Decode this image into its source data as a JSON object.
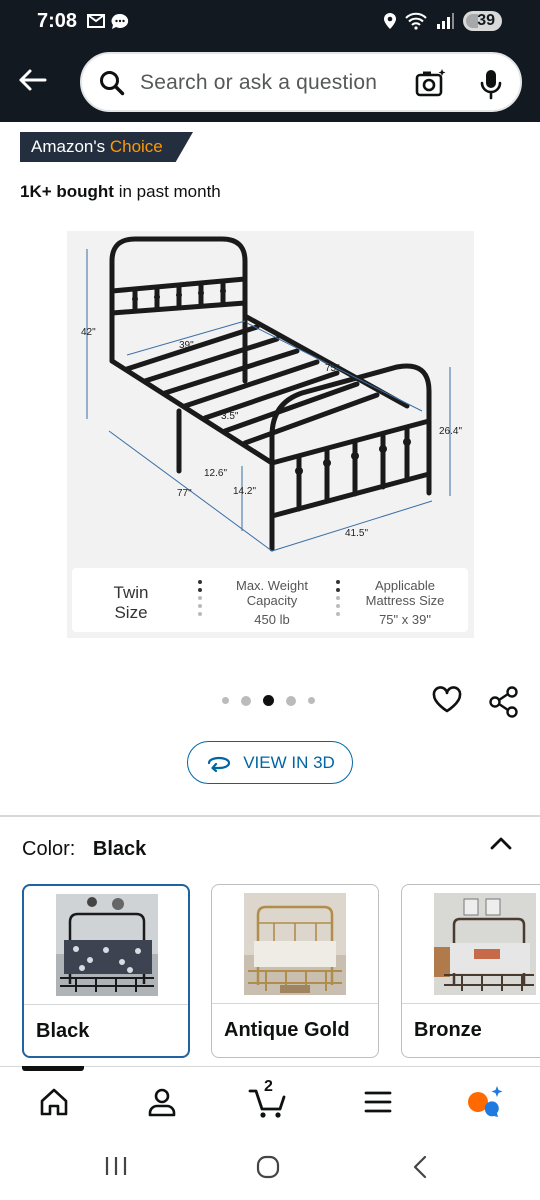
{
  "status": {
    "time": "7:08",
    "battery": "39"
  },
  "search": {
    "placeholder": "Search or ask a question"
  },
  "badge": {
    "prefix": "Amazon's",
    "accent": "Choice"
  },
  "bought": {
    "bold": "1K+ bought",
    "rest": "in past month"
  },
  "product_image": {
    "dims": {
      "headboard_height": "42\"",
      "width": "39\"",
      "length": "75\"",
      "footboard_height": "26.4\"",
      "slat_gap": "3.5\"",
      "clearance_low": "12.6\"",
      "clearance_high": "14.2\"",
      "outer_length": "77\"",
      "outer_width": "41.5\""
    },
    "specs": {
      "size_line1": "Twin",
      "size_line2": "Size",
      "weight_line1": "Max. Weight",
      "weight_line2": "Capacity",
      "weight_value": "450 lb",
      "mattress_line1": "Applicable",
      "mattress_line2": "Mattress Size",
      "mattress_value": "75\" x 39\""
    }
  },
  "carousel": {
    "count": 5,
    "active_index": 2
  },
  "view3d": {
    "label": "VIEW IN 3D"
  },
  "color": {
    "label": "Color:",
    "selected": "Black"
  },
  "swatches": [
    {
      "name": "Black",
      "selected": true
    },
    {
      "name": "Antique Gold",
      "selected": false
    },
    {
      "name": "Bronze",
      "selected": false
    }
  ],
  "cart": {
    "count": "2"
  },
  "colors": {
    "header": "#131921",
    "accent": "#ff9900",
    "link": "#0066a3",
    "selected_border": "#2162a1"
  }
}
